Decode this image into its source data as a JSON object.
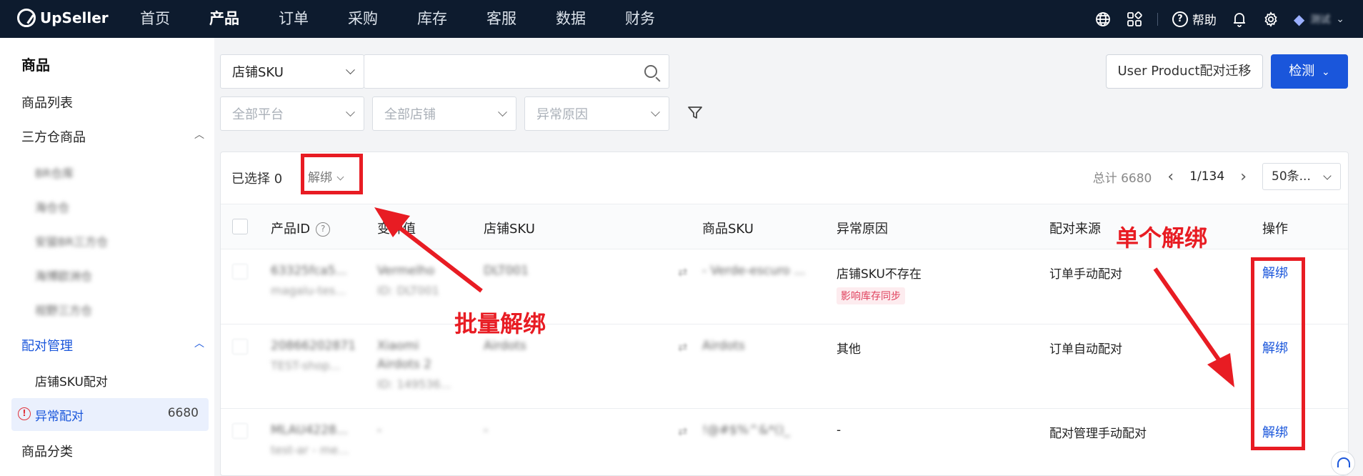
{
  "app": {
    "logo": "UpSeller"
  },
  "nav": {
    "items": [
      "首页",
      "产品",
      "订单",
      "采购",
      "库存",
      "客服",
      "数据",
      "财务"
    ],
    "active": "产品",
    "help_label": "帮助",
    "user_name": "测试"
  },
  "sidebar": {
    "title": "商品",
    "product_list": "商品列表",
    "thirdparty_group": "三方仓商品",
    "thirdparty_subs": [
      "BR仓库",
      "海仓仓",
      "安骏BR三方仓",
      "海博欧洲仓",
      "视野三方仓"
    ],
    "pairing_group": "配对管理",
    "shop_sku_pairing": "店铺SKU配对",
    "abnormal_pairing": "异常配对",
    "abnormal_count": "6680",
    "category": "商品分类"
  },
  "filters": {
    "sku_type": "店铺SKU",
    "search_value": "",
    "platform_placeholder": "全部平台",
    "shop_placeholder": "全部店铺",
    "reason_placeholder": "异常原因"
  },
  "actions": {
    "migrate_label": "User Product配对迁移",
    "detect_label": "检测"
  },
  "table": {
    "selected_text": "已选择 0",
    "batch_unbind": "解绑",
    "total_text": "总计 6680",
    "page_text": "1/134",
    "page_size": "50条...",
    "headers": {
      "product_id": "产品ID",
      "variant": "变种值",
      "shop_sku": "店铺SKU",
      "item_sku": "商品SKU",
      "reason": "异常原因",
      "source": "配对来源",
      "op": "操作"
    },
    "rows": [
      {
        "id_line1": "63325fca5...",
        "id_line2": "magalu-tes...",
        "variant_line1": "Vermelho",
        "variant_line2": "ID: DLT001",
        "variant_line3": "",
        "shop_sku": "DLT001",
        "item_sku": "- Verde-escuro ...",
        "reason": "店铺SKU不存在",
        "reason_tag": "影响库存同步",
        "source": "订单手动配对",
        "op": "解绑"
      },
      {
        "id_line1": "20866202871",
        "id_line2": "TEST-shop...",
        "variant_line1": "Xiaomi",
        "variant_line2": "Airdots 2",
        "variant_line3": "ID: 149536...",
        "shop_sku": "Airdots",
        "item_sku": "Airdots",
        "reason": "其他",
        "reason_tag": "",
        "source": "订单自动配对",
        "op": "解绑"
      },
      {
        "id_line1": "MLAU4228...",
        "id_line2": "test-ar - me...",
        "variant_line1": "-",
        "variant_line2": "",
        "variant_line3": "",
        "shop_sku": "-",
        "item_sku": "!@#$%^&*()_",
        "reason": "-",
        "reason_tag": "",
        "source": "配对管理手动配对",
        "op": "解绑"
      }
    ]
  },
  "annotations": {
    "batch_label": "批量解绑",
    "single_label": "单个解绑",
    "color": "#e81c23"
  },
  "colors": {
    "primary": "#1a56db",
    "nav_bg": "#0d1b2e",
    "danger": "#e0323b"
  }
}
